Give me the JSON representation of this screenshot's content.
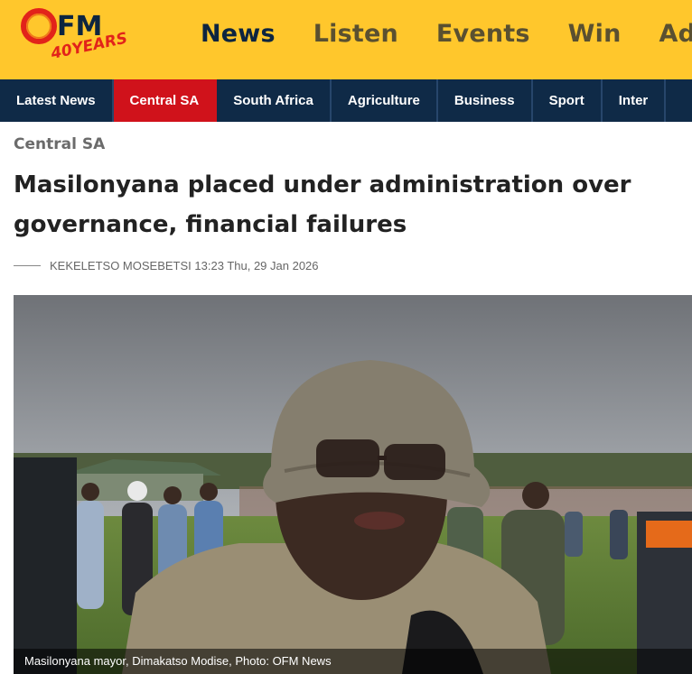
{
  "header": {
    "logo_text": "OFM",
    "logo_subtext": "40YEARS",
    "nav": [
      "News",
      "Listen",
      "Events",
      "Win",
      "Adve"
    ],
    "active_nav": "News"
  },
  "sections": {
    "items": [
      "Latest News",
      "Central SA",
      "South Africa",
      "Agriculture",
      "Business",
      "Sport",
      "Inter"
    ],
    "active": "Central SA"
  },
  "article": {
    "category": "Central SA",
    "title": "Masilonyana placed under administration over governance, financial failures",
    "author": "KEKELETSO MOSEBETSI",
    "datetime": "13:23 Thu, 29 Jan 2026",
    "photo_caption": "Masilonyana mayor, Dimakatso Modise, Photo: OFM News"
  },
  "colors": {
    "header_bg": "#FFC72C",
    "section_bar_bg": "#0F2A47",
    "active_section": "#D0121B",
    "nav_active": "#0d2540"
  }
}
